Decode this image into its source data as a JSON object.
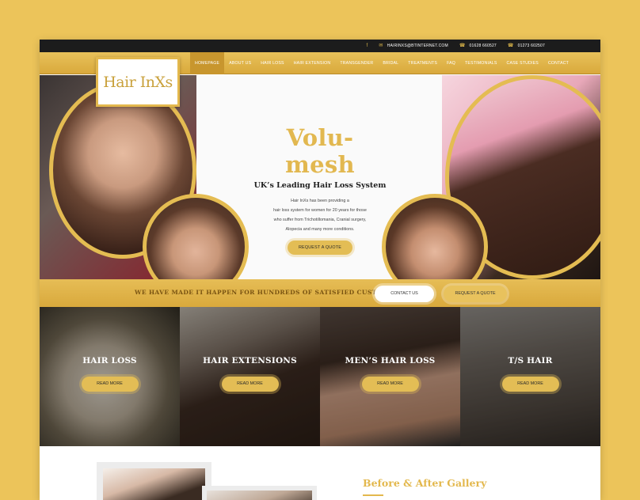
{
  "topbar": {
    "facebook_icon": "f",
    "email_icon": "✉",
    "email": "HAIRINXS@BTINTERNET.COM",
    "phone_icon": "☎",
    "phone1": "01628 660527",
    "phone2": "01273 602507"
  },
  "logo": {
    "text": "Hair InXs"
  },
  "nav": {
    "items": [
      "HOMEPAGE",
      "ABOUT US",
      "HAIR LOSS",
      "HAIR EXTENSION",
      "TRANSGENDER",
      "BRIDAL",
      "TREATMENTS",
      "FAQ",
      "TESTIMONIALS",
      "CASE STUDIES",
      "CONTACT"
    ]
  },
  "hero": {
    "title": "Volu-mesh",
    "subtitle": "UK’s Leading Hair Loss System",
    "desc_lines": [
      "Hair InXs has been providing a",
      "hair loss system for women for 20 years for those",
      "who suffer from Trichotillomania, Cranial surgery,",
      "Alopecia and many more conditions."
    ],
    "button": "REQUEST A QUOTE"
  },
  "banner": {
    "text": "WE HAVE MADE IT HAPPEN FOR HUNDREDS OF SATISFIED CUSTOMERS!",
    "contact_button": "CONTACT US",
    "quote_button": "REQUEST A QUOTE"
  },
  "tiles": [
    {
      "title": "HAIR LOSS",
      "button": "READ MORE"
    },
    {
      "title": "HAIR EXTENSIONS",
      "button": "READ MORE"
    },
    {
      "title": "MEN’S HAIR LOSS",
      "button": "READ MORE"
    },
    {
      "title": "T/S HAIR",
      "button": "READ MORE"
    }
  ],
  "gallery": {
    "title": "Before & After Gallery"
  },
  "colors": {
    "accent": "#e3bd55",
    "background": "#ecc45a",
    "dark": "#1c1c1c"
  }
}
